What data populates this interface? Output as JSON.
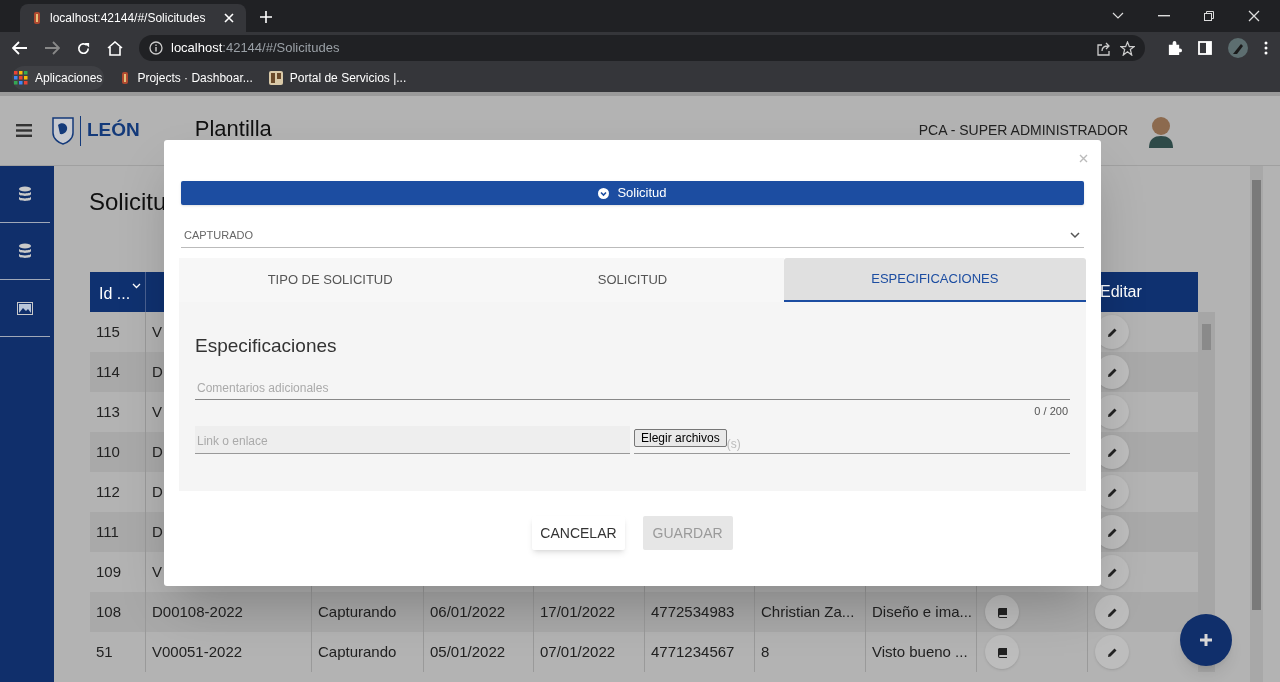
{
  "browser": {
    "tab_title": "localhost:42144/#/Solicitudes",
    "url_host": "localhost",
    "url_rest": ":42144/#/Solicitudes",
    "bookmarks": [
      "Aplicaciones",
      "Projects · Dashboar...",
      "Portal de Servicios |..."
    ]
  },
  "header": {
    "logo_text": "LEÓN",
    "title": "Plantilla",
    "user": "PCA - SUPER ADMINISTRADOR"
  },
  "sidebar": {
    "items": [
      {
        "kind": "database"
      },
      {
        "kind": "database"
      },
      {
        "kind": "image"
      }
    ]
  },
  "page": {
    "title": "Solicitu"
  },
  "table": {
    "id_column": "Id ...",
    "edit_column": "Editar",
    "rows": [
      {
        "cells": [
          "115",
          "V"
        ],
        "book": false
      },
      {
        "cells": [
          "114",
          "D"
        ],
        "book": false
      },
      {
        "cells": [
          "113",
          "V"
        ],
        "book": false
      },
      {
        "cells": [
          "110",
          "D"
        ],
        "book": false
      },
      {
        "cells": [
          "112",
          "D"
        ],
        "book": false
      },
      {
        "cells": [
          "111",
          "D"
        ],
        "book": false
      },
      {
        "cells": [
          "109",
          "V"
        ],
        "book": false
      },
      {
        "cells": [
          "108",
          "D00108-2022",
          "Capturando",
          "06/01/2022",
          "17/01/2022",
          "4772534983",
          "Christian Za...",
          "Diseño e ima..."
        ],
        "book": true
      },
      {
        "cells": [
          "51",
          "V00051-2022",
          "Capturando",
          "05/01/2022",
          "07/01/2022",
          "4771234567",
          "8",
          "Visto bueno ..."
        ],
        "book": true
      }
    ]
  },
  "dialog": {
    "banner": "Solicitud",
    "status": "CAPTURADO",
    "tabs": [
      {
        "label": "TIPO DE SOLICITUD",
        "selected": false
      },
      {
        "label": "SOLICITUD",
        "selected": false
      },
      {
        "label": "ESPECIFICACIONES",
        "selected": true
      }
    ],
    "section_title": "Especificaciones",
    "comments_placeholder": "Comentarios adicionales",
    "counter": "0 / 200",
    "link_placeholder": "Link o enlace",
    "file_button": "Elegir archivos",
    "file_label": "(s)",
    "buttons": [
      {
        "label": "CANCELAR",
        "disabled": false
      },
      {
        "label": "GUARDAR",
        "disabled": true
      }
    ]
  }
}
